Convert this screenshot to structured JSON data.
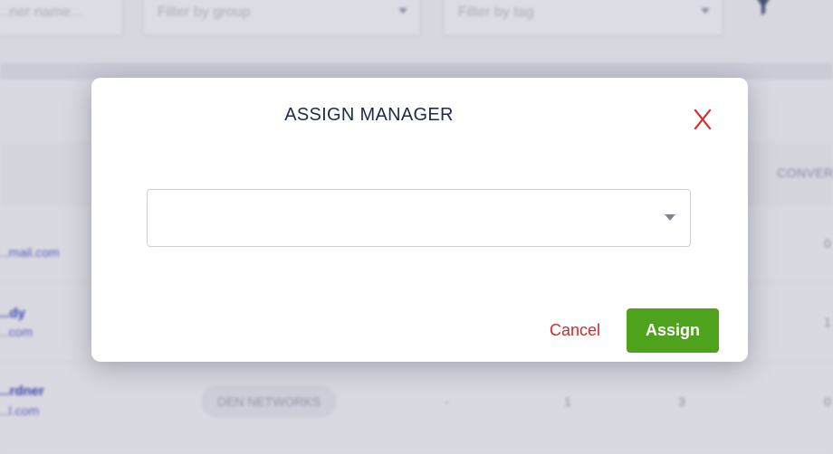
{
  "background": {
    "filters": {
      "name_placeholder": "...ner name...",
      "group_placeholder": "Filter by group",
      "tag_placeholder": "Filter by tag"
    },
    "table": {
      "partial_header": "CONVER",
      "rows": [
        {
          "name": "",
          "email": "...mail.com",
          "value_right": "0"
        },
        {
          "name": "...dy",
          "email": "...com",
          "value_right": "1"
        },
        {
          "name": "...rdner",
          "email": "...l.com",
          "tag": "DEN NETWORKS",
          "col_a": "-",
          "col_b": "1",
          "col_c": "3",
          "value_right": "0"
        }
      ]
    },
    "icons": {
      "filter": "funnel-icon"
    }
  },
  "modal": {
    "title": "ASSIGN MANAGER",
    "close_glyph": "X",
    "close_color": "#d0312d",
    "select": {
      "value": "",
      "options_visible": false
    },
    "cancel_label": "Cancel",
    "assign_label": "Assign",
    "assign_color": "#4ea21c"
  }
}
